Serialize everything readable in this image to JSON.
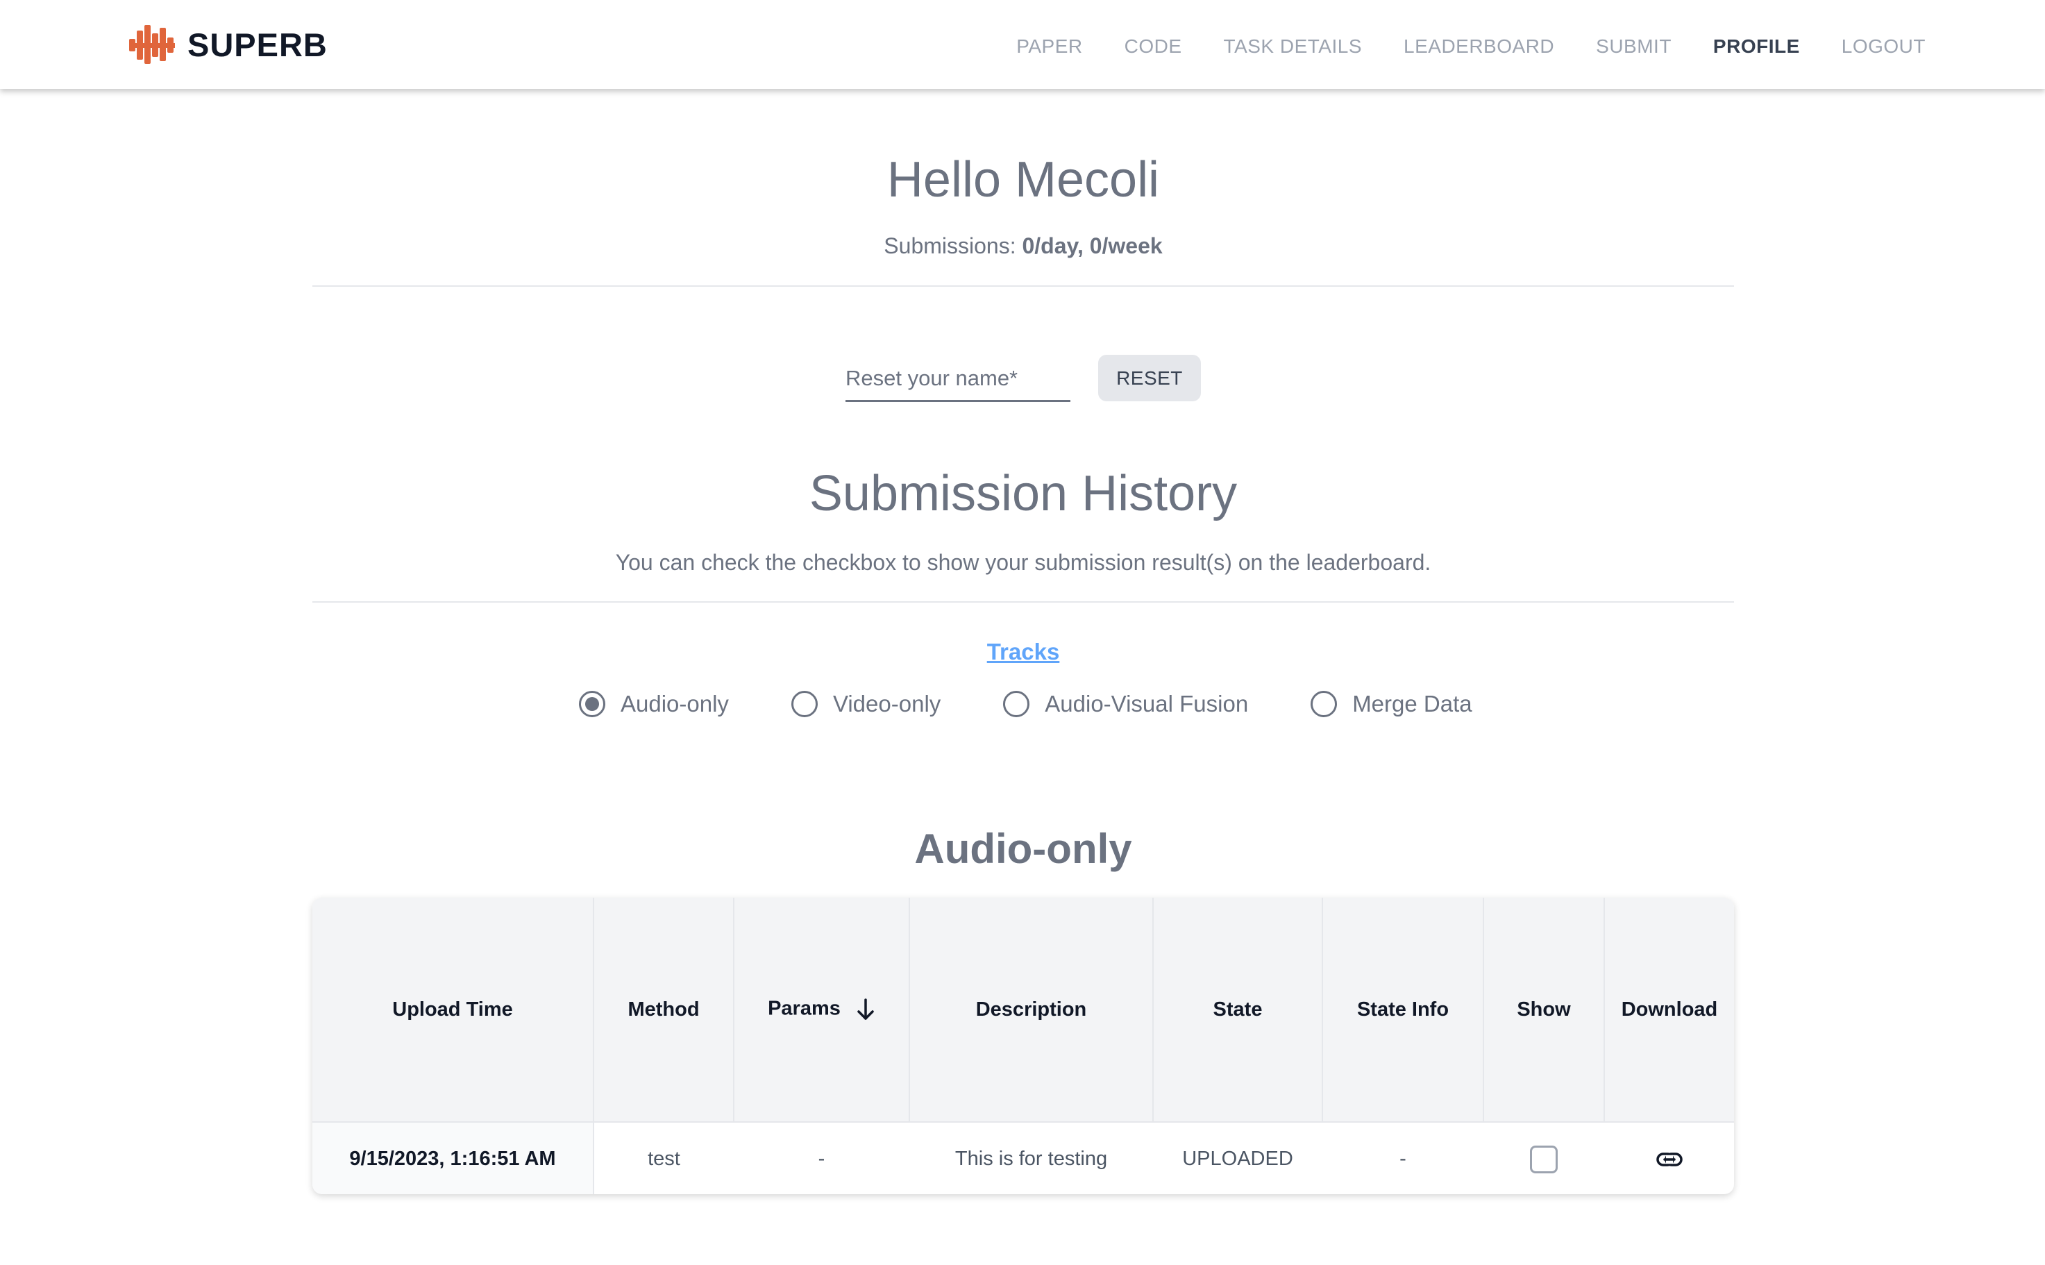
{
  "brand": {
    "name": "SUPERB",
    "logo_icon": "waveform-logo-icon",
    "accent_color": "#e0653b"
  },
  "nav": [
    {
      "label": "PAPER",
      "active": false
    },
    {
      "label": "CODE",
      "active": false
    },
    {
      "label": "TASK DETAILS",
      "active": false
    },
    {
      "label": "LEADERBOARD",
      "active": false
    },
    {
      "label": "SUBMIT",
      "active": false
    },
    {
      "label": "PROFILE",
      "active": true
    },
    {
      "label": "LOGOUT",
      "active": false
    }
  ],
  "profile": {
    "greeting": "Hello Mecoli",
    "quota_label": "Submissions: ",
    "quota_value": "0/day, 0/week",
    "name_placeholder": "Reset your name*",
    "reset_label": "RESET"
  },
  "history": {
    "title": "Submission History",
    "description": "You can check the checkbox to show your submission result(s) on the leaderboard.",
    "tracks_label": "Tracks",
    "tracks": [
      {
        "label": "Audio-only",
        "selected": true
      },
      {
        "label": "Video-only",
        "selected": false
      },
      {
        "label": "Audio-Visual Fusion",
        "selected": false
      },
      {
        "label": "Merge Data",
        "selected": false
      }
    ],
    "current_track": "Audio-only"
  },
  "table": {
    "columns": [
      "Upload Time",
      "Method",
      "Params",
      "Description",
      "State",
      "State Info",
      "Show",
      "Download"
    ],
    "sort_column": "Params",
    "sort_icon": "arrow-down-icon",
    "rows": [
      {
        "upload_time": "9/15/2023, 1:16:51 AM",
        "method": "test",
        "params": "-",
        "description": "This is for testing",
        "state": "UPLOADED",
        "state_info": "-",
        "show": false,
        "download_icon": "link-icon"
      }
    ]
  }
}
